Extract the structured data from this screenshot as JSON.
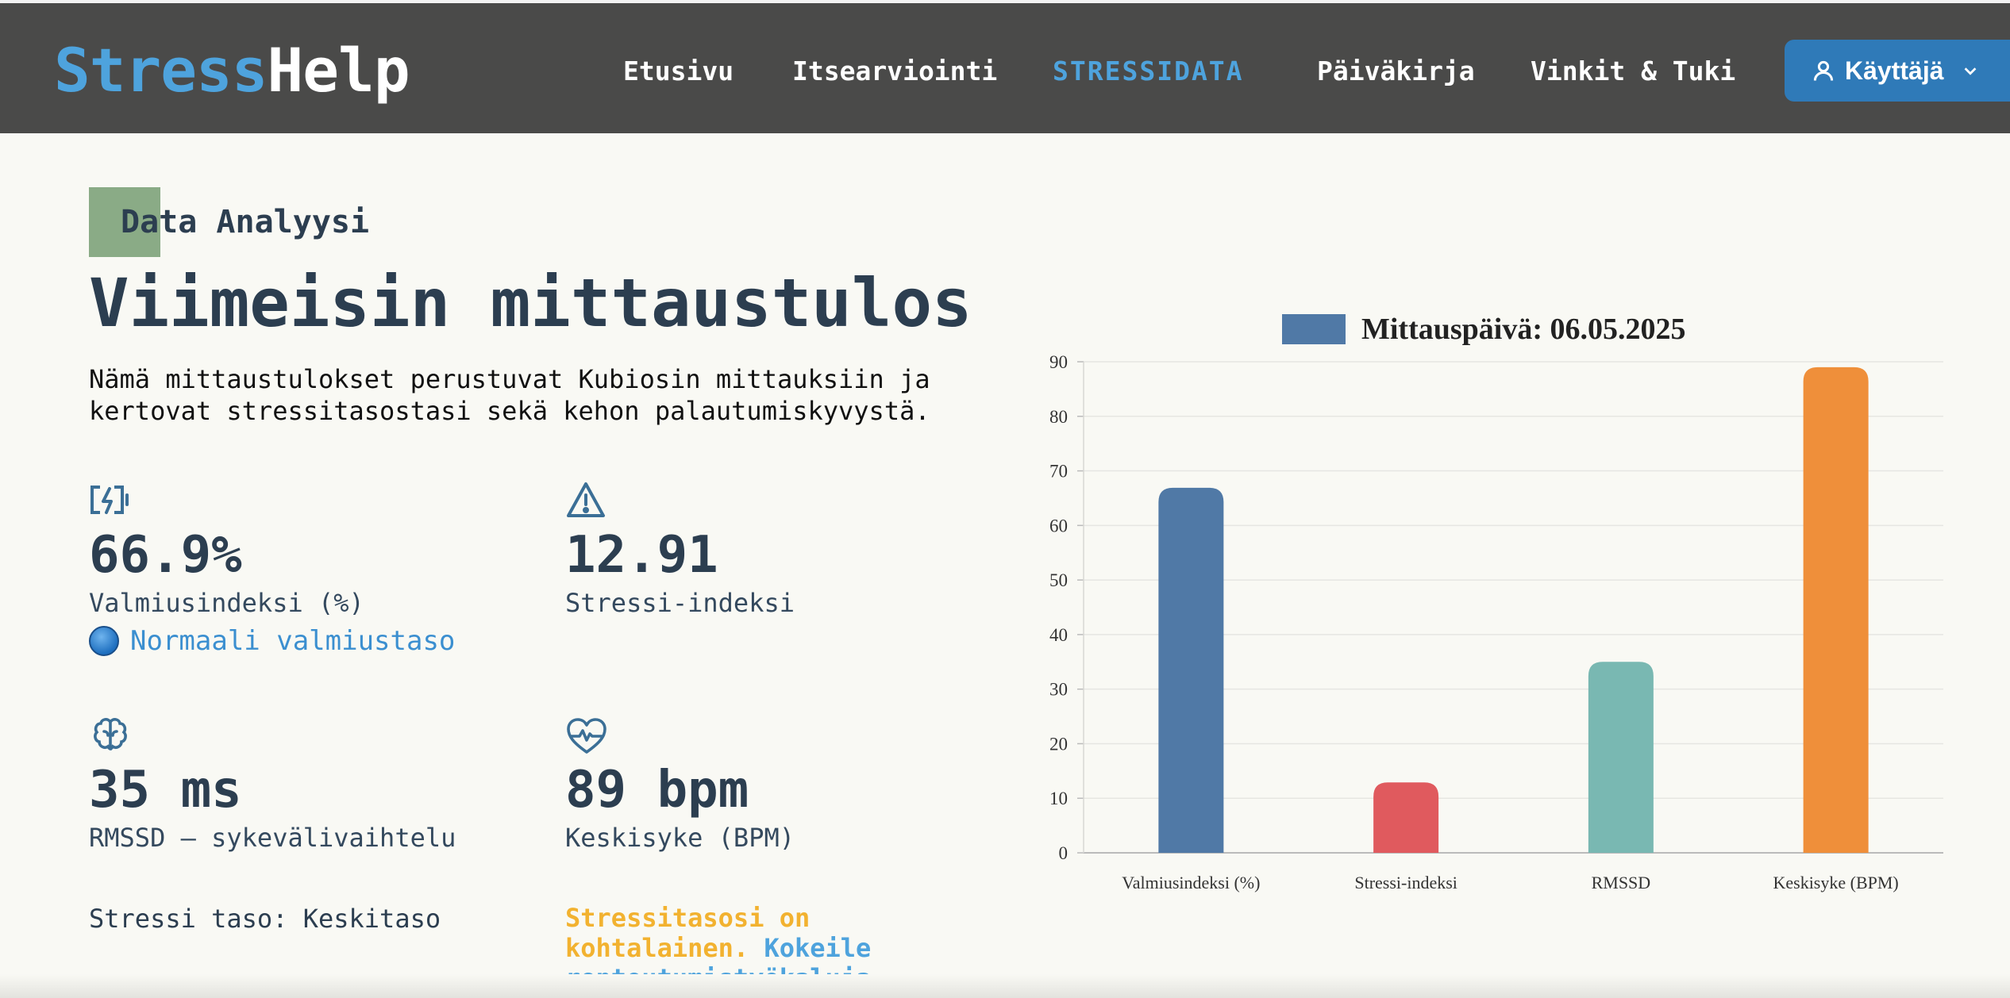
{
  "nav": {
    "brand_part1": "Stress",
    "brand_part2": "Help",
    "links": [
      "Etusivu",
      "Itsearviointi",
      "STRESSIDATA",
      "Päiväkirja",
      "Vinkit & Tuki"
    ],
    "active_link": "STRESSIDATA",
    "user_label": "Käyttäjä"
  },
  "main": {
    "eyebrow": "Data Analyysi",
    "heading": "Viimeisin mittaustulos",
    "intro_line1": "Nämä mittaustulokset perustuvat Kubiosin mittauksiin ja",
    "intro_line2": "kertovat stressitasostasi sekä kehon palautumiskyvystä."
  },
  "metrics": [
    {
      "icon": "battery-charging-icon",
      "value": "66.9%",
      "label": "Valmiusindeksi (%)"
    },
    {
      "icon": "warning-triangle-icon",
      "value": "12.91",
      "label": "Stressi-indeksi"
    },
    {
      "icon": "brain-icon",
      "value": "35 ms",
      "label": "RMSSD – sykevälivaihtelu"
    },
    {
      "icon": "heart-pulse-icon",
      "value": "89 bpm",
      "label": "Keskisyke (BPM)"
    }
  ],
  "status": {
    "readiness_text": "Normaali valmiustaso",
    "stress_level": "Stressi taso: Keskitaso",
    "advice_text": "Stressitasosi on kohtalainen.",
    "advice_link": "Kokeile rentoutumistyökaluja."
  },
  "colors": {
    "accent": "#4ea3dd",
    "navbar": "#4a4a49",
    "advice": "#f2b230"
  },
  "chart_data": {
    "type": "bar",
    "legend": "Mittauspäivä: 06.05.2025",
    "categories": [
      "Valmiusindeksi (%)",
      "Stressi-indeksi",
      "RMSSD",
      "Keskisyke (BPM)"
    ],
    "values": [
      66.9,
      12.91,
      35,
      89
    ],
    "bar_colors": [
      "#5079a6",
      "#e05a5e",
      "#79b8b2",
      "#ef8f3a"
    ],
    "legend_color": "#5079a6",
    "ylim": [
      0,
      90
    ],
    "yticks": [
      0,
      10,
      20,
      30,
      40,
      50,
      60,
      70,
      80,
      90
    ],
    "grid": true,
    "legend_position": "top-center"
  }
}
